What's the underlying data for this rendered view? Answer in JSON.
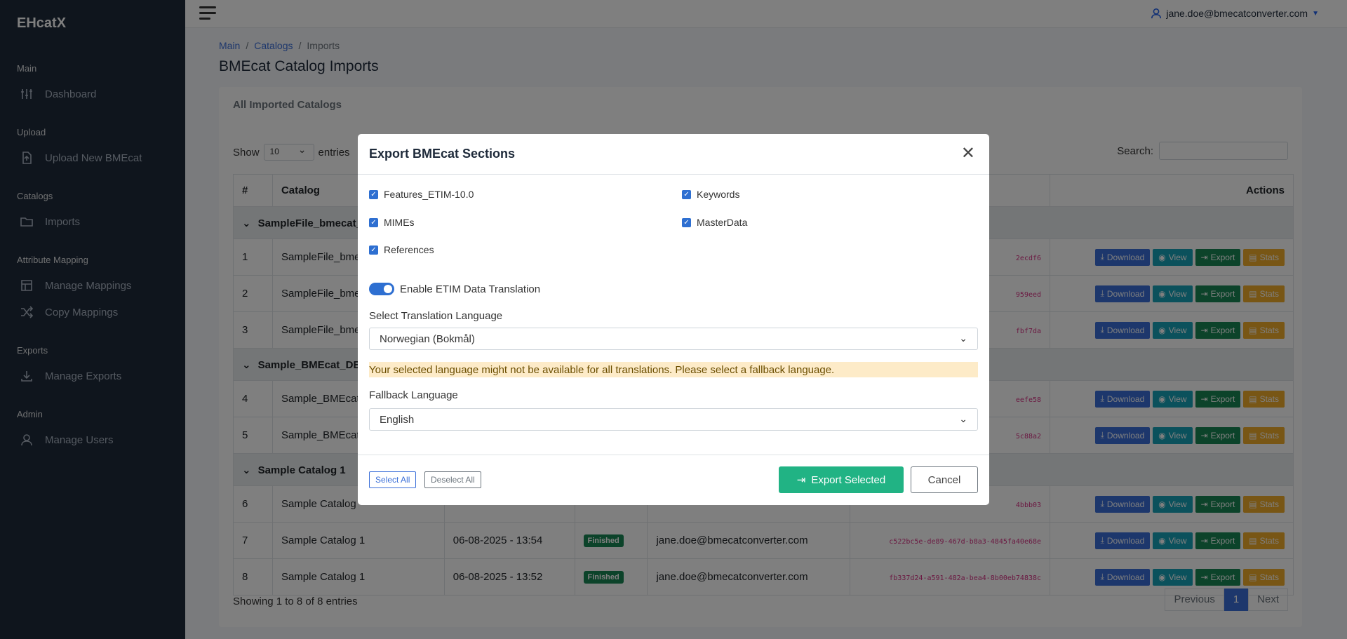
{
  "app": {
    "brand": "EHcatX"
  },
  "sidebar": {
    "sections": [
      {
        "title": "Main",
        "items": [
          {
            "label": "Dashboard",
            "icon": "sliders-icon"
          }
        ]
      },
      {
        "title": "Upload",
        "items": [
          {
            "label": "Upload New BMEcat",
            "icon": "file-upload-icon"
          }
        ]
      },
      {
        "title": "Catalogs",
        "items": [
          {
            "label": "Imports",
            "icon": "folder-icon"
          }
        ]
      },
      {
        "title": "Attribute Mapping",
        "items": [
          {
            "label": "Manage Mappings",
            "icon": "table-icon"
          },
          {
            "label": "Copy Mappings",
            "icon": "shuffle-icon"
          }
        ]
      },
      {
        "title": "Exports",
        "items": [
          {
            "label": "Manage Exports",
            "icon": "download-icon"
          }
        ]
      },
      {
        "title": "Admin",
        "items": [
          {
            "label": "Manage Users",
            "icon": "user-icon"
          }
        ]
      }
    ]
  },
  "header": {
    "user_email": "jane.doe@bmecatconverter.com"
  },
  "breadcrumb": [
    "Main",
    "Catalogs",
    "Imports"
  ],
  "page": {
    "title": "BMEcat Catalog Imports",
    "card_title": "All Imported Catalogs"
  },
  "table_controls": {
    "show_label": "Show",
    "page_size": "10",
    "entries_label": "entries",
    "search_label": "Search:"
  },
  "table": {
    "headers": [
      "#",
      "Catalog",
      "Actions"
    ],
    "groups": [
      {
        "name": "SampleFile_bmecat_",
        "rows": [
          {
            "num": "1",
            "catalog": "SampleFile_bme",
            "date": "",
            "status": "",
            "user": "",
            "hash": "2ecdf6"
          },
          {
            "num": "2",
            "catalog": "SampleFile_bme",
            "date": "",
            "status": "",
            "user": "",
            "hash": "959eed"
          },
          {
            "num": "3",
            "catalog": "SampleFile_bme",
            "date": "",
            "status": "",
            "user": "",
            "hash": "fbf7da"
          }
        ]
      },
      {
        "name": "Sample_BMEcat_DE_",
        "rows": [
          {
            "num": "4",
            "catalog": "Sample_BMEcat",
            "date": "",
            "status": "",
            "user": "",
            "hash": "eefe58"
          },
          {
            "num": "5",
            "catalog": "Sample_BMEcat",
            "date": "",
            "status": "",
            "user": "",
            "hash": "5c88a2"
          }
        ]
      },
      {
        "name": "Sample Catalog 1",
        "rows": [
          {
            "num": "6",
            "catalog": "Sample Catalog",
            "date": "",
            "status": "",
            "user": "",
            "hash": "4bbb03"
          },
          {
            "num": "7",
            "catalog": "Sample Catalog 1",
            "date": "06-08-2025 - 13:54",
            "status": "Finished",
            "user": "jane.doe@bmecatconverter.com",
            "hash": "c522bc5e-de89-467d-b8a3-4845fa40e68e"
          },
          {
            "num": "8",
            "catalog": "Sample Catalog 1",
            "date": "06-08-2025 - 13:52",
            "status": "Finished",
            "user": "jane.doe@bmecatconverter.com",
            "hash": "fb337d24-a591-482a-bea4-8b00eb74838c"
          }
        ]
      }
    ],
    "actions": {
      "download": "Download",
      "view": "View",
      "export": "Export",
      "stats": "Stats"
    }
  },
  "pagination": {
    "info": "Showing 1 to 8 of 8 entries",
    "previous": "Previous",
    "current": "1",
    "next": "Next"
  },
  "modal": {
    "title": "Export BMEcat Sections",
    "sections": [
      "Features_ETIM-10.0",
      "Keywords",
      "MIMEs",
      "MasterData",
      "References"
    ],
    "toggle_label": "Enable ETIM Data Translation",
    "translation_label": "Select Translation Language",
    "translation_value": "Norwegian (Bokmål)",
    "warning": "Your selected language might not be available for all translations. Please select a fallback language.",
    "fallback_label": "Fallback Language",
    "fallback_value": "English",
    "select_all": "Select All",
    "deselect_all": "Deselect All",
    "export_selected": "Export Selected",
    "cancel": "Cancel"
  },
  "colors": {
    "primary": "#3b6fd8",
    "success": "#21b384",
    "sidebar": "#1e2a3a",
    "warning_bg": "#fdebc8"
  }
}
